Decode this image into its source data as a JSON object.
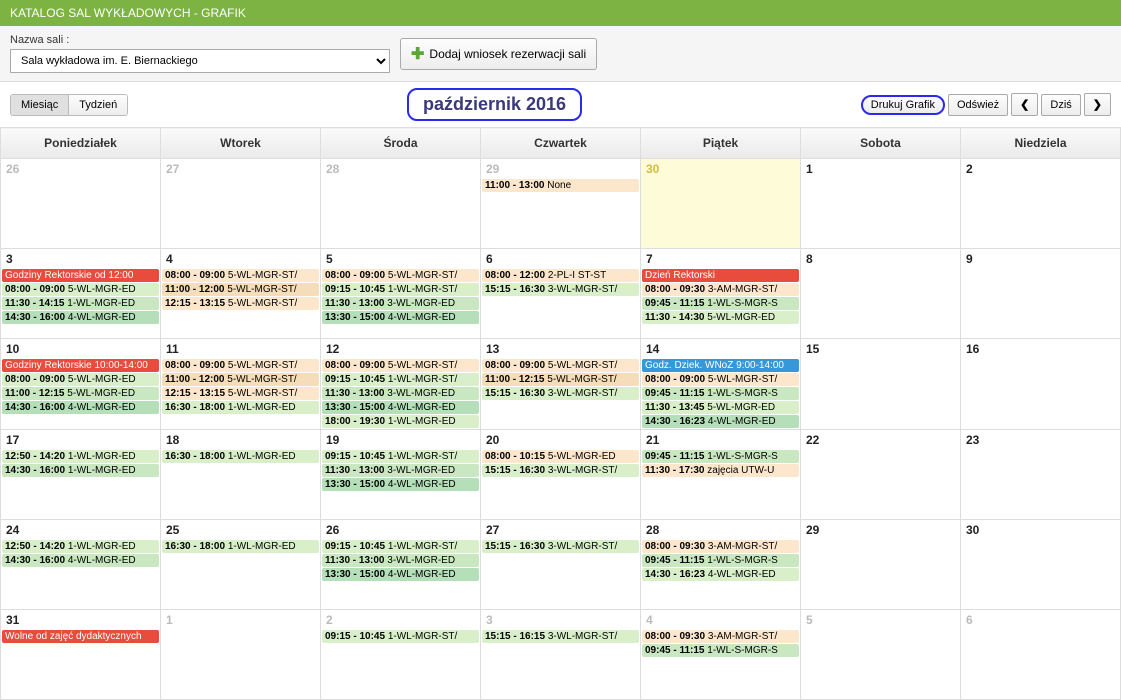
{
  "header": {
    "title": "KATALOG SAL WYKŁADOWYCH - GRAFIK"
  },
  "controls": {
    "room_label": "Nazwa sali  :",
    "room_value": "Sala wykładowa im. E. Biernackiego",
    "add_btn": "Dodaj wniosek rezerwacji sali"
  },
  "toolbar": {
    "view_month": "Miesiąc",
    "view_week": "Tydzień",
    "title": "październik 2016",
    "print": "Drukuj Grafik",
    "refresh": "Odśwież",
    "prev": "❮",
    "today": "Dziś",
    "next": "❯"
  },
  "days": [
    "Poniedziałek",
    "Wtorek",
    "Środa",
    "Czwartek",
    "Piątek",
    "Sobota",
    "Niedziela"
  ],
  "weeks": [
    [
      {
        "num": "26",
        "dim": true,
        "events": []
      },
      {
        "num": "27",
        "dim": true,
        "events": []
      },
      {
        "num": "28",
        "dim": true,
        "events": []
      },
      {
        "num": "29",
        "dim": true,
        "events": [
          {
            "t": "11:00 - 13:00",
            "x": "None",
            "c": "ev-orange1"
          }
        ]
      },
      {
        "num": "30",
        "dim": true,
        "today": true,
        "events": []
      },
      {
        "num": "1",
        "events": []
      },
      {
        "num": "2",
        "events": []
      }
    ],
    [
      {
        "num": "3",
        "events": [
          {
            "t": "",
            "x": "Godziny Rektorskie od 12:00",
            "c": "ev-red"
          },
          {
            "t": "08:00 - 09:00",
            "x": "5-WL-MGR-ED",
            "c": "ev-green2"
          },
          {
            "t": "11:30 - 14:15",
            "x": "1-WL-MGR-ED",
            "c": "ev-green1"
          },
          {
            "t": "14:30 - 16:00",
            "x": "4-WL-MGR-ED",
            "c": "ev-green3"
          }
        ]
      },
      {
        "num": "4",
        "events": [
          {
            "t": "08:00 - 09:00",
            "x": "5-WL-MGR-ST/",
            "c": "ev-orange1"
          },
          {
            "t": "11:00 - 12:00",
            "x": "5-WL-MGR-ST/",
            "c": "ev-orange2"
          },
          {
            "t": "12:15 - 13:15",
            "x": "5-WL-MGR-ST/",
            "c": "ev-orange1"
          }
        ]
      },
      {
        "num": "5",
        "events": [
          {
            "t": "08:00 - 09:00",
            "x": "5-WL-MGR-ST/",
            "c": "ev-orange1"
          },
          {
            "t": "09:15 - 10:45",
            "x": "1-WL-MGR-ST/",
            "c": "ev-green2"
          },
          {
            "t": "11:30 - 13:00",
            "x": "3-WL-MGR-ED",
            "c": "ev-green1"
          },
          {
            "t": "13:30 - 15:00",
            "x": "4-WL-MGR-ED",
            "c": "ev-green3"
          }
        ]
      },
      {
        "num": "6",
        "events": [
          {
            "t": "08:00 - 12:00",
            "x": "2-PL-I ST-ST",
            "c": "ev-orange1"
          },
          {
            "t": "15:15 - 16:30",
            "x": "3-WL-MGR-ST/",
            "c": "ev-green2"
          }
        ]
      },
      {
        "num": "7",
        "events": [
          {
            "t": "",
            "x": "Dzień Rektorski",
            "c": "ev-red"
          },
          {
            "t": "08:00 - 09:30",
            "x": "3-AM-MGR-ST/",
            "c": "ev-orange1"
          },
          {
            "t": "09:45 - 11:15",
            "x": "1-WL-S-MGR-S",
            "c": "ev-green1"
          },
          {
            "t": "11:30 - 14:30",
            "x": "5-WL-MGR-ED",
            "c": "ev-green2"
          }
        ]
      },
      {
        "num": "8",
        "events": []
      },
      {
        "num": "9",
        "events": []
      }
    ],
    [
      {
        "num": "10",
        "events": [
          {
            "t": "",
            "x": "Godziny Rektorskie 10:00-14:00",
            "c": "ev-red"
          },
          {
            "t": "08:00 - 09:00",
            "x": "5-WL-MGR-ED",
            "c": "ev-green2"
          },
          {
            "t": "11:00 - 12:15",
            "x": "5-WL-MGR-ED",
            "c": "ev-green1"
          },
          {
            "t": "14:30 - 16:00",
            "x": "4-WL-MGR-ED",
            "c": "ev-green3"
          }
        ]
      },
      {
        "num": "11",
        "events": [
          {
            "t": "08:00 - 09:00",
            "x": "5-WL-MGR-ST/",
            "c": "ev-orange1"
          },
          {
            "t": "11:00 - 12:00",
            "x": "5-WL-MGR-ST/",
            "c": "ev-orange2"
          },
          {
            "t": "12:15 - 13:15",
            "x": "5-WL-MGR-ST/",
            "c": "ev-orange1"
          },
          {
            "t": "16:30 - 18:00",
            "x": "1-WL-MGR-ED",
            "c": "ev-green2"
          }
        ]
      },
      {
        "num": "12",
        "events": [
          {
            "t": "08:00 - 09:00",
            "x": "5-WL-MGR-ST/",
            "c": "ev-orange1"
          },
          {
            "t": "09:15 - 10:45",
            "x": "1-WL-MGR-ST/",
            "c": "ev-green2"
          },
          {
            "t": "11:30 - 13:00",
            "x": "3-WL-MGR-ED",
            "c": "ev-green1"
          },
          {
            "t": "13:30 - 15:00",
            "x": "4-WL-MGR-ED",
            "c": "ev-green3"
          },
          {
            "t": "18:00 - 19:30",
            "x": "1-WL-MGR-ED",
            "c": "ev-green2"
          }
        ]
      },
      {
        "num": "13",
        "events": [
          {
            "t": "08:00 - 09:00",
            "x": "5-WL-MGR-ST/",
            "c": "ev-orange1"
          },
          {
            "t": "11:00 - 12:15",
            "x": "5-WL-MGR-ST/",
            "c": "ev-orange2"
          },
          {
            "t": "15:15 - 16:30",
            "x": "3-WL-MGR-ST/",
            "c": "ev-green2"
          }
        ]
      },
      {
        "num": "14",
        "events": [
          {
            "t": "",
            "x": "Godz. Dziek. WNoZ 9:00-14:00",
            "c": "ev-blue"
          },
          {
            "t": "08:00 - 09:00",
            "x": "5-WL-MGR-ST/",
            "c": "ev-orange1"
          },
          {
            "t": "09:45 - 11:15",
            "x": "1-WL-S-MGR-S",
            "c": "ev-green1"
          },
          {
            "t": "11:30 - 13:45",
            "x": "5-WL-MGR-ED",
            "c": "ev-green2"
          },
          {
            "t": "14:30 - 16:23",
            "x": "4-WL-MGR-ED",
            "c": "ev-green3"
          }
        ]
      },
      {
        "num": "15",
        "events": []
      },
      {
        "num": "16",
        "events": []
      }
    ],
    [
      {
        "num": "17",
        "events": [
          {
            "t": "12:50 - 14:20",
            "x": "1-WL-MGR-ED",
            "c": "ev-green2"
          },
          {
            "t": "14:30 - 16:00",
            "x": "1-WL-MGR-ED",
            "c": "ev-green1"
          }
        ]
      },
      {
        "num": "18",
        "events": [
          {
            "t": "16:30 - 18:00",
            "x": "1-WL-MGR-ED",
            "c": "ev-green2"
          }
        ]
      },
      {
        "num": "19",
        "events": [
          {
            "t": "09:15 - 10:45",
            "x": "1-WL-MGR-ST/",
            "c": "ev-green2"
          },
          {
            "t": "11:30 - 13:00",
            "x": "3-WL-MGR-ED",
            "c": "ev-green1"
          },
          {
            "t": "13:30 - 15:00",
            "x": "4-WL-MGR-ED",
            "c": "ev-green3"
          }
        ]
      },
      {
        "num": "20",
        "events": [
          {
            "t": "08:00 - 10:15",
            "x": "5-WL-MGR-ED",
            "c": "ev-orange1"
          },
          {
            "t": "15:15 - 16:30",
            "x": "3-WL-MGR-ST/",
            "c": "ev-green2"
          }
        ]
      },
      {
        "num": "21",
        "events": [
          {
            "t": "09:45 - 11:15",
            "x": "1-WL-S-MGR-S",
            "c": "ev-green1"
          },
          {
            "t": "11:30 - 17:30",
            "x": "zajęcia UTW-U",
            "c": "ev-orange1"
          }
        ]
      },
      {
        "num": "22",
        "events": []
      },
      {
        "num": "23",
        "events": []
      }
    ],
    [
      {
        "num": "24",
        "events": [
          {
            "t": "12:50 - 14:20",
            "x": "1-WL-MGR-ED",
            "c": "ev-green2"
          },
          {
            "t": "14:30 - 16:00",
            "x": "4-WL-MGR-ED",
            "c": "ev-green1"
          }
        ]
      },
      {
        "num": "25",
        "events": [
          {
            "t": "16:30 - 18:00",
            "x": "1-WL-MGR-ED",
            "c": "ev-green2"
          }
        ]
      },
      {
        "num": "26",
        "events": [
          {
            "t": "09:15 - 10:45",
            "x": "1-WL-MGR-ST/",
            "c": "ev-green2"
          },
          {
            "t": "11:30 - 13:00",
            "x": "3-WL-MGR-ED",
            "c": "ev-green1"
          },
          {
            "t": "13:30 - 15:00",
            "x": "4-WL-MGR-ED",
            "c": "ev-green3"
          }
        ]
      },
      {
        "num": "27",
        "events": [
          {
            "t": "15:15 - 16:30",
            "x": "3-WL-MGR-ST/",
            "c": "ev-green2"
          }
        ]
      },
      {
        "num": "28",
        "events": [
          {
            "t": "08:00 - 09:30",
            "x": "3-AM-MGR-ST/",
            "c": "ev-orange1"
          },
          {
            "t": "09:45 - 11:15",
            "x": "1-WL-S-MGR-S",
            "c": "ev-green1"
          },
          {
            "t": "14:30 - 16:23",
            "x": "4-WL-MGR-ED",
            "c": "ev-green2"
          }
        ]
      },
      {
        "num": "29",
        "events": []
      },
      {
        "num": "30",
        "events": []
      }
    ],
    [
      {
        "num": "31",
        "events": [
          {
            "t": "",
            "x": "Wolne od zajęć dydaktycznych",
            "c": "ev-red"
          }
        ]
      },
      {
        "num": "1",
        "dim": true,
        "events": []
      },
      {
        "num": "2",
        "dim": true,
        "events": [
          {
            "t": "09:15 - 10:45",
            "x": "1-WL-MGR-ST/",
            "c": "ev-green2"
          }
        ]
      },
      {
        "num": "3",
        "dim": true,
        "events": [
          {
            "t": "15:15 - 16:15",
            "x": "3-WL-MGR-ST/",
            "c": "ev-green2"
          }
        ]
      },
      {
        "num": "4",
        "dim": true,
        "events": [
          {
            "t": "08:00 - 09:30",
            "x": "3-AM-MGR-ST/",
            "c": "ev-orange1"
          },
          {
            "t": "09:45 - 11:15",
            "x": "1-WL-S-MGR-S",
            "c": "ev-green1"
          }
        ]
      },
      {
        "num": "5",
        "dim": true,
        "events": []
      },
      {
        "num": "6",
        "dim": true,
        "events": []
      }
    ]
  ]
}
